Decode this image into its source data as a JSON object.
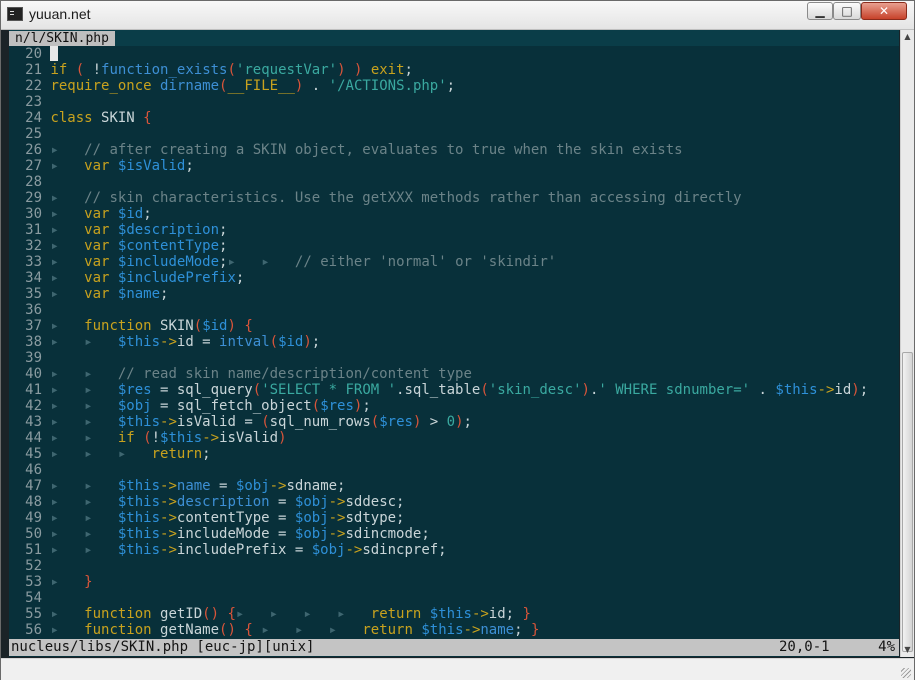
{
  "window": {
    "title": "yuuan.net"
  },
  "tab": {
    "label": "n/l/SKIN.php"
  },
  "colors": {
    "keyword": "#c8a21e",
    "var": "#268bd2",
    "string": "#2aa198",
    "comment": "#657b83",
    "text": "#c9d5d8",
    "background": "#08303a"
  },
  "code_lines": [
    {
      "n": "20",
      "cursor": true,
      "t": []
    },
    {
      "n": "21",
      "t": [
        [
          "if",
          "k"
        ],
        [
          " ",
          "p"
        ],
        [
          "(",
          "r"
        ],
        [
          " ",
          "p"
        ],
        [
          "!",
          "p"
        ],
        [
          "function_exists",
          "b"
        ],
        [
          "(",
          "r"
        ],
        [
          "'requestVar'",
          "s"
        ],
        [
          ")",
          "r"
        ],
        [
          " ",
          "p"
        ],
        [
          ")",
          "r"
        ],
        [
          " ",
          "p"
        ],
        [
          "exit",
          "k"
        ],
        [
          ";",
          "p"
        ]
      ]
    },
    {
      "n": "22",
      "t": [
        [
          "require_once",
          "k"
        ],
        [
          " ",
          "p"
        ],
        [
          "dirname",
          "b"
        ],
        [
          "(",
          "r"
        ],
        [
          "__FILE__",
          "k"
        ],
        [
          ")",
          "r"
        ],
        [
          " . ",
          "p"
        ],
        [
          "'/ACTIONS.php'",
          "s"
        ],
        [
          ";",
          "p"
        ]
      ]
    },
    {
      "n": "23",
      "t": []
    },
    {
      "n": "24",
      "t": [
        [
          "class",
          "k"
        ],
        [
          " SKIN ",
          "p"
        ],
        [
          "{",
          "r"
        ]
      ]
    },
    {
      "n": "25",
      "t": []
    },
    {
      "n": "26",
      "t": [
        [
          "▸   ",
          "m"
        ],
        [
          "// after creating a SKIN object, evaluates to true when the skin exists",
          "c"
        ]
      ]
    },
    {
      "n": "27",
      "t": [
        [
          "▸   ",
          "m"
        ],
        [
          "var",
          "k"
        ],
        [
          " ",
          "p"
        ],
        [
          "$isValid",
          "v"
        ],
        [
          ";",
          "p"
        ]
      ]
    },
    {
      "n": "28",
      "t": []
    },
    {
      "n": "29",
      "t": [
        [
          "▸   ",
          "m"
        ],
        [
          "// skin characteristics. Use the getXXX methods rather than accessing directly",
          "c"
        ]
      ]
    },
    {
      "n": "30",
      "t": [
        [
          "▸   ",
          "m"
        ],
        [
          "var",
          "k"
        ],
        [
          " ",
          "p"
        ],
        [
          "$id",
          "v"
        ],
        [
          ";",
          "p"
        ]
      ]
    },
    {
      "n": "31",
      "t": [
        [
          "▸   ",
          "m"
        ],
        [
          "var",
          "k"
        ],
        [
          " ",
          "p"
        ],
        [
          "$description",
          "v"
        ],
        [
          ";",
          "p"
        ]
      ]
    },
    {
      "n": "32",
      "t": [
        [
          "▸   ",
          "m"
        ],
        [
          "var",
          "k"
        ],
        [
          " ",
          "p"
        ],
        [
          "$contentType",
          "v"
        ],
        [
          ";",
          "p"
        ]
      ]
    },
    {
      "n": "33",
      "t": [
        [
          "▸   ",
          "m"
        ],
        [
          "var",
          "k"
        ],
        [
          " ",
          "p"
        ],
        [
          "$includeMode",
          "v"
        ],
        [
          ";",
          "p"
        ],
        [
          "▸   ▸   ",
          "m"
        ],
        [
          "// either 'normal' or 'skindir'",
          "c"
        ]
      ]
    },
    {
      "n": "34",
      "t": [
        [
          "▸   ",
          "m"
        ],
        [
          "var",
          "k"
        ],
        [
          " ",
          "p"
        ],
        [
          "$includePrefix",
          "v"
        ],
        [
          ";",
          "p"
        ]
      ]
    },
    {
      "n": "35",
      "t": [
        [
          "▸   ",
          "m"
        ],
        [
          "var",
          "k"
        ],
        [
          " ",
          "p"
        ],
        [
          "$name",
          "v"
        ],
        [
          ";",
          "p"
        ]
      ]
    },
    {
      "n": "36",
      "t": []
    },
    {
      "n": "37",
      "t": [
        [
          "▸   ",
          "m"
        ],
        [
          "function",
          "k"
        ],
        [
          " SKIN",
          "p"
        ],
        [
          "(",
          "r"
        ],
        [
          "$id",
          "v"
        ],
        [
          ")",
          "r"
        ],
        [
          " ",
          "p"
        ],
        [
          "{",
          "r"
        ]
      ]
    },
    {
      "n": "38",
      "t": [
        [
          "▸   ▸   ",
          "m"
        ],
        [
          "$this",
          "v"
        ],
        [
          "->",
          "k"
        ],
        [
          "id = ",
          "p"
        ],
        [
          "intval",
          "b"
        ],
        [
          "(",
          "r"
        ],
        [
          "$id",
          "v"
        ],
        [
          ")",
          "r"
        ],
        [
          ";",
          "p"
        ]
      ]
    },
    {
      "n": "39",
      "t": []
    },
    {
      "n": "40",
      "t": [
        [
          "▸   ▸   ",
          "m"
        ],
        [
          "// read skin name/description/content type",
          "c"
        ]
      ]
    },
    {
      "n": "41",
      "t": [
        [
          "▸   ▸   ",
          "m"
        ],
        [
          "$res",
          "v"
        ],
        [
          " = sql_query",
          "p"
        ],
        [
          "(",
          "r"
        ],
        [
          "'SELECT * FROM '",
          "s"
        ],
        [
          ".sql_table",
          "p"
        ],
        [
          "(",
          "r"
        ],
        [
          "'skin_desc'",
          "s"
        ],
        [
          ")",
          "r"
        ],
        [
          ".",
          "p"
        ],
        [
          "' WHERE sdnumber='",
          "s"
        ],
        [
          " . ",
          "p"
        ],
        [
          "$this",
          "v"
        ],
        [
          "->",
          "k"
        ],
        [
          "id",
          "p"
        ],
        [
          ")",
          "r"
        ],
        [
          ";",
          "p"
        ]
      ]
    },
    {
      "n": "42",
      "t": [
        [
          "▸   ▸   ",
          "m"
        ],
        [
          "$obj",
          "v"
        ],
        [
          " = sql_fetch_object",
          "p"
        ],
        [
          "(",
          "r"
        ],
        [
          "$res",
          "v"
        ],
        [
          ")",
          "r"
        ],
        [
          ";",
          "p"
        ]
      ]
    },
    {
      "n": "43",
      "t": [
        [
          "▸   ▸   ",
          "m"
        ],
        [
          "$this",
          "v"
        ],
        [
          "->",
          "k"
        ],
        [
          "isValid = ",
          "p"
        ],
        [
          "(",
          "r"
        ],
        [
          "sql_num_rows",
          "p"
        ],
        [
          "(",
          "r"
        ],
        [
          "$res",
          "v"
        ],
        [
          ")",
          "r"
        ],
        [
          " > ",
          "p"
        ],
        [
          "0",
          "s"
        ],
        [
          ")",
          "r"
        ],
        [
          ";",
          "p"
        ]
      ]
    },
    {
      "n": "44",
      "t": [
        [
          "▸   ▸   ",
          "m"
        ],
        [
          "if",
          "k"
        ],
        [
          " ",
          "p"
        ],
        [
          "(",
          "r"
        ],
        [
          "!",
          "p"
        ],
        [
          "$this",
          "v"
        ],
        [
          "->",
          "k"
        ],
        [
          "isValid",
          "p"
        ],
        [
          ")",
          "r"
        ]
      ]
    },
    {
      "n": "45",
      "t": [
        [
          "▸   ▸   ▸   ",
          "m"
        ],
        [
          "return",
          "k"
        ],
        [
          ";",
          "p"
        ]
      ]
    },
    {
      "n": "46",
      "t": []
    },
    {
      "n": "47",
      "t": [
        [
          "▸   ▸   ",
          "m"
        ],
        [
          "$this",
          "v"
        ],
        [
          "->",
          "k"
        ],
        [
          "name",
          "b"
        ],
        [
          " = ",
          "p"
        ],
        [
          "$obj",
          "v"
        ],
        [
          "->",
          "k"
        ],
        [
          "sdname;",
          "p"
        ]
      ]
    },
    {
      "n": "48",
      "t": [
        [
          "▸   ▸   ",
          "m"
        ],
        [
          "$this",
          "v"
        ],
        [
          "->",
          "k"
        ],
        [
          "description",
          "b"
        ],
        [
          " = ",
          "p"
        ],
        [
          "$obj",
          "v"
        ],
        [
          "->",
          "k"
        ],
        [
          "sddesc;",
          "p"
        ]
      ]
    },
    {
      "n": "49",
      "t": [
        [
          "▸   ▸   ",
          "m"
        ],
        [
          "$this",
          "v"
        ],
        [
          "->",
          "k"
        ],
        [
          "contentType = ",
          "p"
        ],
        [
          "$obj",
          "v"
        ],
        [
          "->",
          "k"
        ],
        [
          "sdtype;",
          "p"
        ]
      ]
    },
    {
      "n": "50",
      "t": [
        [
          "▸   ▸   ",
          "m"
        ],
        [
          "$this",
          "v"
        ],
        [
          "->",
          "k"
        ],
        [
          "includeMode = ",
          "p"
        ],
        [
          "$obj",
          "v"
        ],
        [
          "->",
          "k"
        ],
        [
          "sdincmode;",
          "p"
        ]
      ]
    },
    {
      "n": "51",
      "t": [
        [
          "▸   ▸   ",
          "m"
        ],
        [
          "$this",
          "v"
        ],
        [
          "->",
          "k"
        ],
        [
          "includePrefix = ",
          "p"
        ],
        [
          "$obj",
          "v"
        ],
        [
          "->",
          "k"
        ],
        [
          "sdincpref;",
          "p"
        ]
      ]
    },
    {
      "n": "52",
      "t": []
    },
    {
      "n": "53",
      "t": [
        [
          "▸   ",
          "m"
        ],
        [
          "}",
          "r"
        ]
      ]
    },
    {
      "n": "54",
      "t": []
    },
    {
      "n": "55",
      "t": [
        [
          "▸   ",
          "m"
        ],
        [
          "function",
          "k"
        ],
        [
          " getID",
          "p"
        ],
        [
          "()",
          "r"
        ],
        [
          " ",
          "p"
        ],
        [
          "{",
          "r"
        ],
        [
          "▸   ▸   ▸   ▸   ",
          "m"
        ],
        [
          "return",
          "k"
        ],
        [
          " ",
          "p"
        ],
        [
          "$this",
          "v"
        ],
        [
          "->",
          "k"
        ],
        [
          "id; ",
          "p"
        ],
        [
          "}",
          "r"
        ]
      ]
    },
    {
      "n": "56",
      "t": [
        [
          "▸   ",
          "m"
        ],
        [
          "function",
          "k"
        ],
        [
          " getName",
          "p"
        ],
        [
          "()",
          "r"
        ],
        [
          " ",
          "p"
        ],
        [
          "{",
          "r"
        ],
        [
          " ▸   ▸   ▸   ",
          "m"
        ],
        [
          "return",
          "k"
        ],
        [
          " ",
          "p"
        ],
        [
          "$this",
          "v"
        ],
        [
          "->",
          "k"
        ],
        [
          "name",
          "b"
        ],
        [
          "; ",
          "p"
        ],
        [
          "}",
          "r"
        ]
      ]
    }
  ],
  "statusline": {
    "file": "nucleus/libs/SKIN.php [euc-jp][unix]",
    "position": "20,0-1",
    "percent": "4%"
  }
}
